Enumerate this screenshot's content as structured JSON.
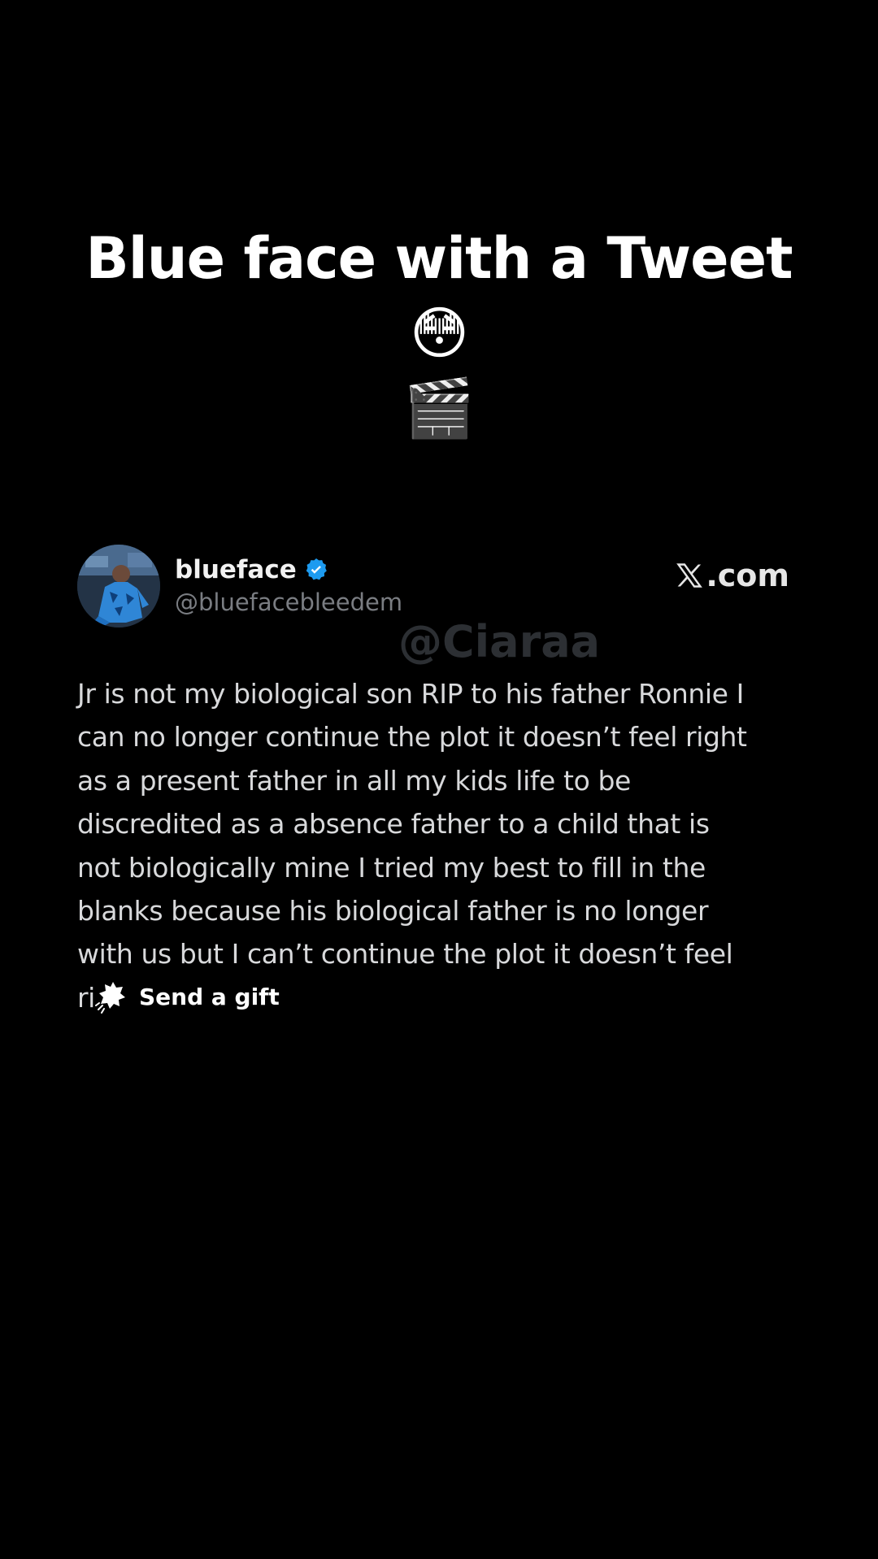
{
  "caption": {
    "text": "Blue face with a Tweet",
    "emoji_1": "😳",
    "emoji_2": "🎬"
  },
  "tweet": {
    "display_name": "blueface",
    "handle": "@bluefacebleedem",
    "source": ".com",
    "watermark": "@Ciaraa",
    "text_lines": [
      "Jr is not my biological son RIP to his father Ronnie I",
      "can no longer continue the plot it doesn’t feel right",
      "as a present father in all my kids life to be",
      "discredited as a absence father to a child that is",
      "not biologically mine I tried my best to fill in the",
      "blanks because his biological father is no longer",
      "with us but I can’t continue the plot it doesn’t feel",
      "ri"
    ],
    "icons": {
      "verified": "verified-badge-icon",
      "platform": "x-logo-icon",
      "avatar": "profile-photo"
    },
    "colors": {
      "verified": "#1d9bf0",
      "text": "#d8d9db",
      "handle": "#7a7d82"
    }
  },
  "gift": {
    "label": "Send a gift",
    "icon": "gift-icon"
  }
}
